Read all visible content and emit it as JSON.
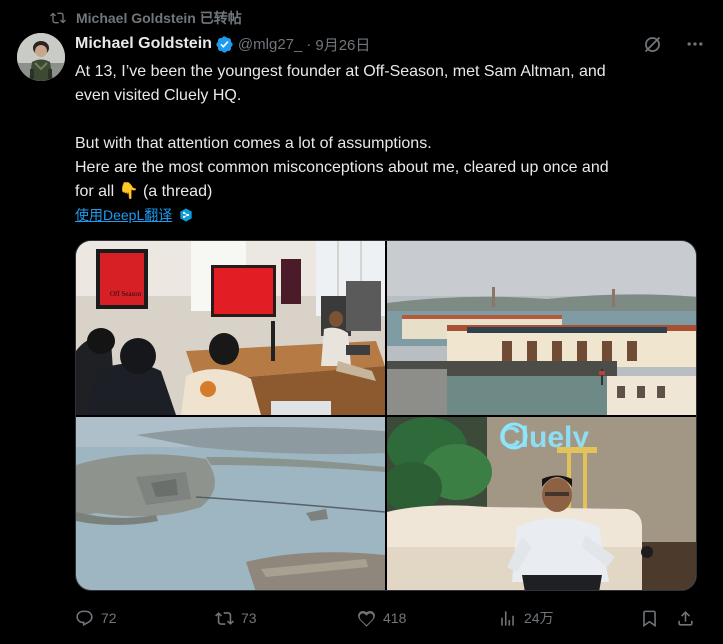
{
  "retweet_banner": {
    "icon": "retweet-icon",
    "text": "Michael Goldstein 已转帖"
  },
  "author": {
    "name": "Michael Goldstein",
    "handle": "@mlg27_",
    "separator": "·",
    "date": "9月26日",
    "verified": true,
    "verified_color": "#1d9bf0"
  },
  "tweet": {
    "lines": [
      "At 13, I’ve been the youngest founder at Off-Season, met Sam Altman, and",
      "even visited Cluely HQ.",
      "",
      "But with that attention comes a lot of assumptions.",
      "Here are the most common misconceptions about me, cleared up once and",
      "for all 👇 (a thread)"
    ],
    "translate_label": "使用DeepL翻译"
  },
  "media": {
    "photos": [
      {
        "name": "office-presentation-photo",
        "sign_text": "Off Season"
      },
      {
        "name": "pier-bay-photo"
      },
      {
        "name": "aerial-city-photo"
      },
      {
        "name": "cluely-hq-photo",
        "sign_text": "Cluely"
      }
    ]
  },
  "actions": {
    "replies": "72",
    "reposts": "73",
    "likes": "418",
    "views": "24万"
  },
  "colors": {
    "background": "#000000",
    "text": "#e7e9ea",
    "muted": "#71767b",
    "accent": "#1d9bf0"
  }
}
